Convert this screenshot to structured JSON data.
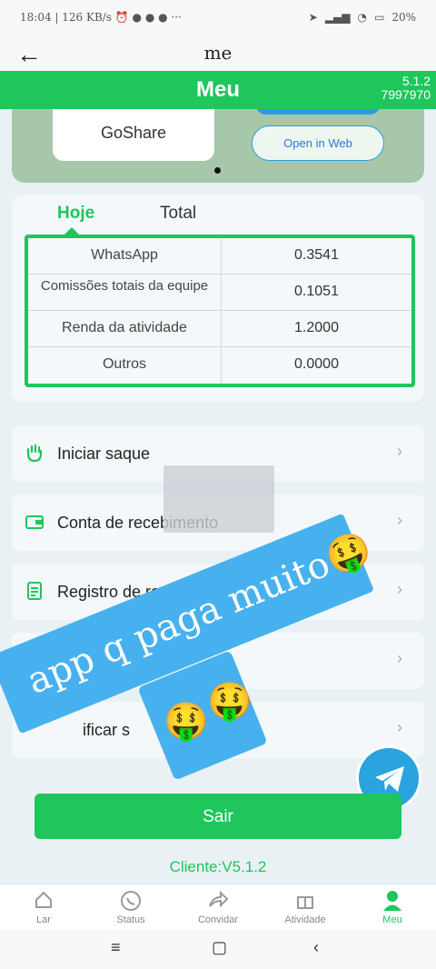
{
  "status_bar": {
    "time": "18:04",
    "speed": "126 KB/s",
    "battery": "20%"
  },
  "header": {
    "title": "me"
  },
  "green_bar": {
    "title": "Meu",
    "version": "5.1.2",
    "id": "7997970"
  },
  "banner": {
    "app_name": "GoShare",
    "open_web": "Open in Web"
  },
  "earnings": {
    "tabs": [
      "Hoje",
      "Total"
    ],
    "rows": [
      {
        "label": "WhatsApp",
        "value": "0.3541"
      },
      {
        "label": "Comissões totais da equipe",
        "value": "0.1051"
      },
      {
        "label": "Renda da atividade",
        "value": "1.2000"
      },
      {
        "label": "Outros",
        "value": "0.0000"
      }
    ]
  },
  "menu": [
    {
      "label": "Iniciar saque",
      "icon": "hand-icon"
    },
    {
      "label": "Conta de recebimento",
      "icon": "wallet-icon"
    },
    {
      "label": "Registro de receit",
      "icon": "document-icon"
    },
    {
      "label": "",
      "icon": "list-icon"
    },
    {
      "label": "ificar s",
      "icon": "edit-icon"
    }
  ],
  "overlay": {
    "sticker_text": "app q paga muito",
    "emoji": "🤑"
  },
  "logout": {
    "label": "Sair"
  },
  "client_version": "Cliente:V5.1.2",
  "bottom_nav": [
    {
      "label": "Lar"
    },
    {
      "label": "Status"
    },
    {
      "label": "Convidar"
    },
    {
      "label": "Atividade"
    },
    {
      "label": "Meu"
    }
  ],
  "colors": {
    "accent": "#1ec65c",
    "sticker": "#47b1ef",
    "telegram": "#2aa3df"
  }
}
